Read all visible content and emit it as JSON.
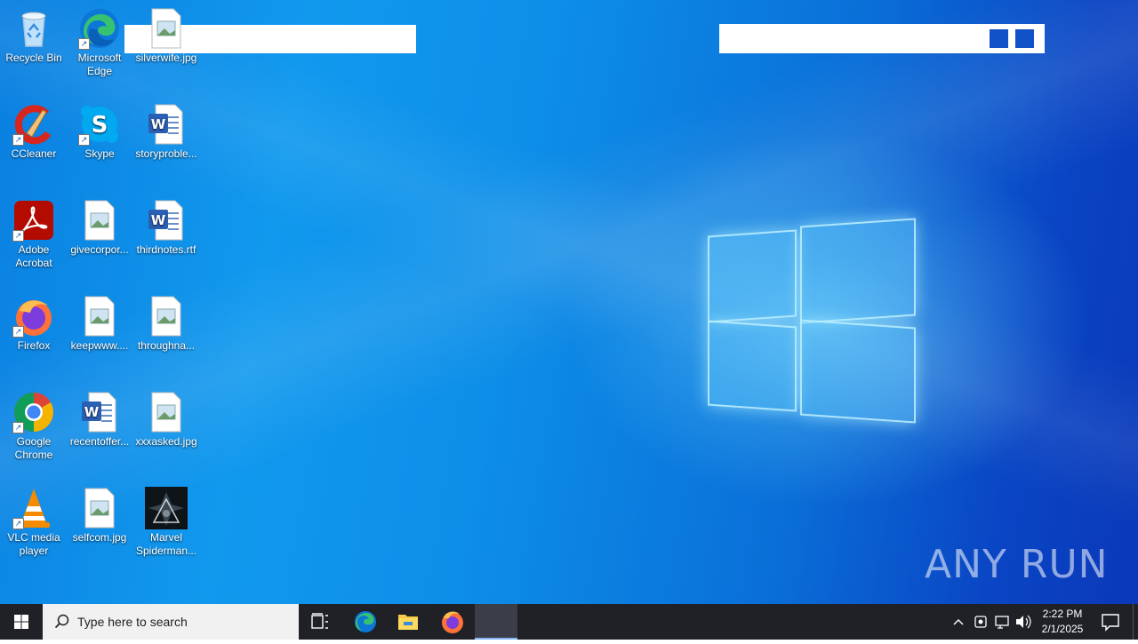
{
  "desktop": {
    "icons": [
      {
        "label": "Recycle Bin",
        "icon": "recycle-bin-icon"
      },
      {
        "label": "Microsoft Edge",
        "icon": "edge-icon"
      },
      {
        "label": "silverwife.jpg",
        "icon": "image-file-icon"
      },
      {
        "label": "CCleaner",
        "icon": "ccleaner-icon"
      },
      {
        "label": "Skype",
        "icon": "skype-icon"
      },
      {
        "label": "storyproble...",
        "icon": "word-doc-icon"
      },
      {
        "label": "Adobe Acrobat",
        "icon": "acrobat-icon"
      },
      {
        "label": "givecorpor...",
        "icon": "image-file-icon"
      },
      {
        "label": "thirdnotes.rtf",
        "icon": "word-doc-icon"
      },
      {
        "label": "Firefox",
        "icon": "firefox-icon"
      },
      {
        "label": "keepwww....",
        "icon": "image-file-icon"
      },
      {
        "label": "throughna...",
        "icon": "image-file-icon"
      },
      {
        "label": "Google Chrome",
        "icon": "chrome-icon"
      },
      {
        "label": "recentoffer...",
        "icon": "word-doc-icon"
      },
      {
        "label": "xxxasked.jpg",
        "icon": "image-file-icon"
      },
      {
        "label": "VLC media player",
        "icon": "vlc-icon"
      },
      {
        "label": "selfcom.jpg",
        "icon": "image-file-icon"
      },
      {
        "label": "Marvel Spiderman...",
        "icon": "marvel-thumbnail-icon"
      }
    ],
    "watermark": "ANY RUN"
  },
  "taskbar": {
    "search_placeholder": "Type here to search",
    "pinned": [
      "task-view-icon",
      "edge-icon",
      "file-explorer-icon",
      "firefox-icon",
      "active-app"
    ],
    "tray_icons": [
      "chevron-up-icon",
      "meet-icon",
      "network-icon",
      "volume-icon"
    ],
    "time": "2:22 PM",
    "date": "2/1/2025"
  },
  "colors": {
    "accent_blue": "#1152c8",
    "taskbar": "#1f2127"
  }
}
